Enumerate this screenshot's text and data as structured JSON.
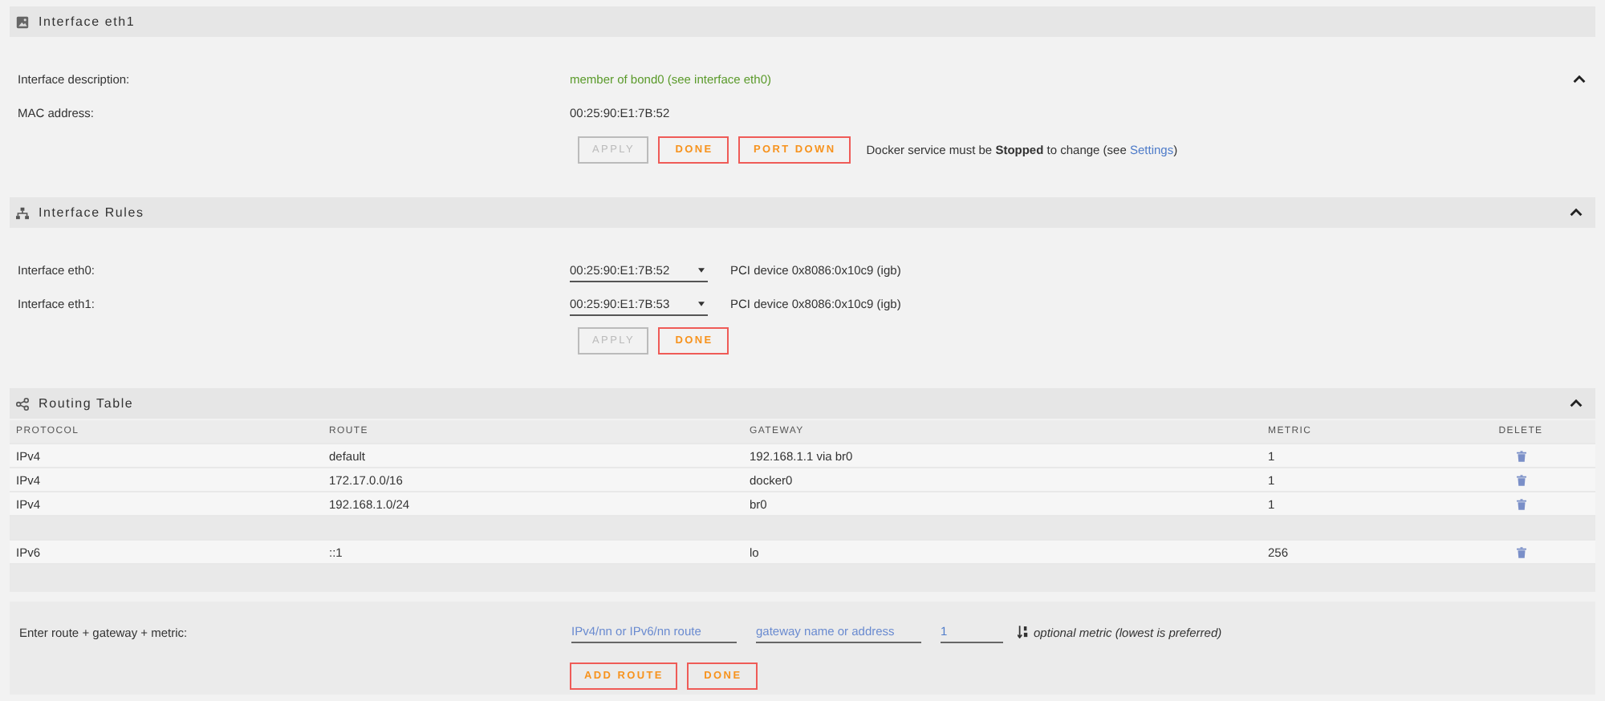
{
  "interface_section": {
    "title": "Interface eth1",
    "fields": [
      {
        "label": "Interface description:",
        "value": "member of bond0 (see interface eth0)",
        "kind": "link"
      },
      {
        "label": "MAC address:",
        "value": "00:25:90:E1:7B:52",
        "kind": "text"
      }
    ],
    "buttons": [
      {
        "label": "APPLY",
        "disabled": true
      },
      {
        "label": "DONE",
        "disabled": false
      },
      {
        "label": "PORT DOWN",
        "disabled": false
      }
    ],
    "note": {
      "before": "Docker service must be **Stopped** to change (see ",
      "link": "Settings",
      "after": ")"
    }
  },
  "rules_section": {
    "title": "Interface Rules",
    "rows": [
      {
        "label": "Interface eth0:",
        "value": "00:25:90:E1:7B:52",
        "device": "PCI device 0x8086:0x10c9 (igb)"
      },
      {
        "label": "Interface eth1:",
        "value": "00:25:90:E1:7B:53",
        "device": "PCI device 0x8086:0x10c9 (igb)"
      }
    ],
    "buttons": [
      {
        "label": "APPLY",
        "disabled": true
      },
      {
        "label": "DONE",
        "disabled": false
      }
    ]
  },
  "routing_section": {
    "title": "Routing Table",
    "columns": [
      "PROTOCOL",
      "ROUTE",
      "GATEWAY",
      "METRIC",
      "DELETE"
    ],
    "rows": [
      {
        "kind": "route",
        "protocol": "IPv4",
        "route": "default",
        "gateway": "192.168.1.1 via br0",
        "metric": "1"
      },
      {
        "kind": "route",
        "protocol": "IPv4",
        "route": "172.17.0.0/16",
        "gateway": "docker0",
        "metric": "1"
      },
      {
        "kind": "route",
        "protocol": "IPv4",
        "route": "192.168.1.0/24",
        "gateway": "br0",
        "metric": "1"
      },
      {
        "kind": "gap"
      },
      {
        "kind": "route",
        "protocol": "IPv6",
        "route": "::1",
        "gateway": "lo",
        "metric": "256"
      }
    ]
  },
  "add_route": {
    "label": "Enter route + gateway + metric:",
    "route_placeholder": "IPv4/nn or IPv6/nn route",
    "gateway_placeholder": "gateway name or address",
    "metric_value": "1",
    "hint": "optional metric (lowest is preferred)",
    "buttons": [
      {
        "label": "ADD ROUTE",
        "disabled": false
      },
      {
        "label": "DONE",
        "disabled": false
      }
    ]
  }
}
